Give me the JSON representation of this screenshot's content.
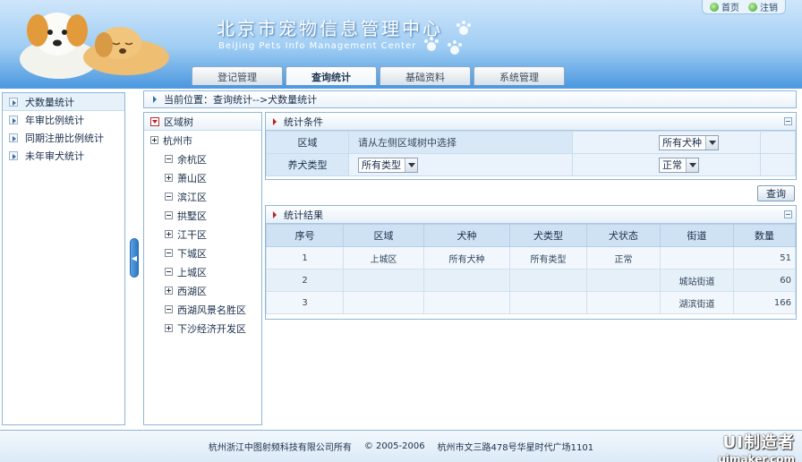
{
  "header": {
    "title": "北京市宠物信息管理中心",
    "subtitle": "BeiJing Pets Info Management Center",
    "links": [
      {
        "label": "首页",
        "icon": "home-icon"
      },
      {
        "label": "注销",
        "icon": "logout-icon"
      }
    ]
  },
  "nav": {
    "tabs": [
      {
        "label": "登记管理",
        "active": false
      },
      {
        "label": "查询统计",
        "active": true
      },
      {
        "label": "基础资料",
        "active": false
      },
      {
        "label": "系统管理",
        "active": false
      }
    ]
  },
  "sidebar": {
    "items": [
      {
        "label": "犬数量统计",
        "active": true
      },
      {
        "label": "年审比例统计",
        "active": false
      },
      {
        "label": "同期注册比例统计",
        "active": false
      },
      {
        "label": "未年审犬统计",
        "active": false
      }
    ]
  },
  "breadcrumb": {
    "text": "当前位置：查询统计-->犬数量统计"
  },
  "tree": {
    "title": "区域树",
    "root": {
      "label": "杭州市",
      "icon": "plus"
    },
    "children": [
      {
        "label": "余杭区",
        "icon": "leaf"
      },
      {
        "label": "萧山区",
        "icon": "plus"
      },
      {
        "label": "滨江区",
        "icon": "leaf"
      },
      {
        "label": "拱墅区",
        "icon": "leaf"
      },
      {
        "label": "江干区",
        "icon": "plus"
      },
      {
        "label": "下城区",
        "icon": "leaf"
      },
      {
        "label": "上城区",
        "icon": "leaf"
      },
      {
        "label": "西湖区",
        "icon": "plus"
      },
      {
        "label": "西湖风景名胜区",
        "icon": "leaf"
      },
      {
        "label": "下沙经济开发区",
        "icon": "plus"
      }
    ]
  },
  "conditions": {
    "title": "统计条件",
    "region_label": "区域",
    "region_hint": "请从左侧区域树中选择",
    "breed_select": "所有犬种",
    "type_label": "养犬类型",
    "type_select": "所有类型",
    "status_select": "正常"
  },
  "query_button": "查询",
  "results": {
    "title": "统计结果",
    "columns": [
      "序号",
      "区域",
      "犬种",
      "犬类型",
      "犬状态",
      "街道",
      "数量"
    ],
    "rows": [
      {
        "no": "1",
        "region": "上城区",
        "breed": "所有犬种",
        "type": "所有类型",
        "status": "正常",
        "street": "",
        "count": "51"
      },
      {
        "no": "2",
        "region": "",
        "breed": "",
        "type": "",
        "status": "",
        "street": "城站街道",
        "count": "60"
      },
      {
        "no": "3",
        "region": "",
        "breed": "",
        "type": "",
        "status": "",
        "street": "湖滨街道",
        "count": "166"
      }
    ]
  },
  "footer": {
    "company": "杭州浙江中图射频科技有限公司所有",
    "copyright": "© 2005-2006",
    "address": "杭州市文三路478号华星时代广场1101"
  },
  "watermark": {
    "line1": "UI制造者",
    "line2": "uimaker.com"
  },
  "colors": {
    "header_blue": "#4f9ae0",
    "panel_border": "#8fb6d8",
    "accent_red": "#c02020"
  }
}
